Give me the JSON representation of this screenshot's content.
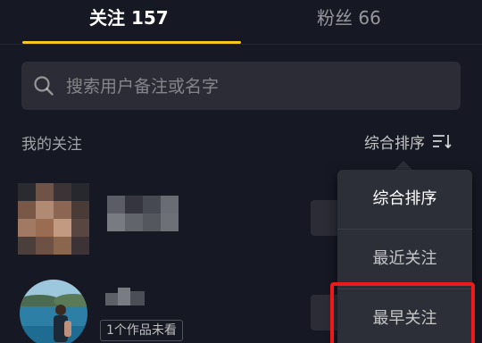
{
  "tabs": {
    "following_label": "关注 157",
    "fans_label": "粉丝 66"
  },
  "search": {
    "placeholder": "搜索用户备注或名字"
  },
  "list_header": {
    "title": "我的关注",
    "sort_label": "综合排序"
  },
  "rows": [
    {
      "avatar": "pixelated-avatar",
      "name": ""
    },
    {
      "avatar": "photo-avatar",
      "name": "",
      "badge": "1个作品未看"
    }
  ],
  "sort_menu": {
    "items": [
      {
        "label": "综合排序",
        "selected": true
      },
      {
        "label": "最近关注",
        "selected": false
      },
      {
        "label": "最早关注",
        "selected": false
      }
    ],
    "highlighted_index": 2
  },
  "colors": {
    "background": "#161823",
    "accent": "#f7c81c",
    "highlight": "#ec1a1a"
  }
}
